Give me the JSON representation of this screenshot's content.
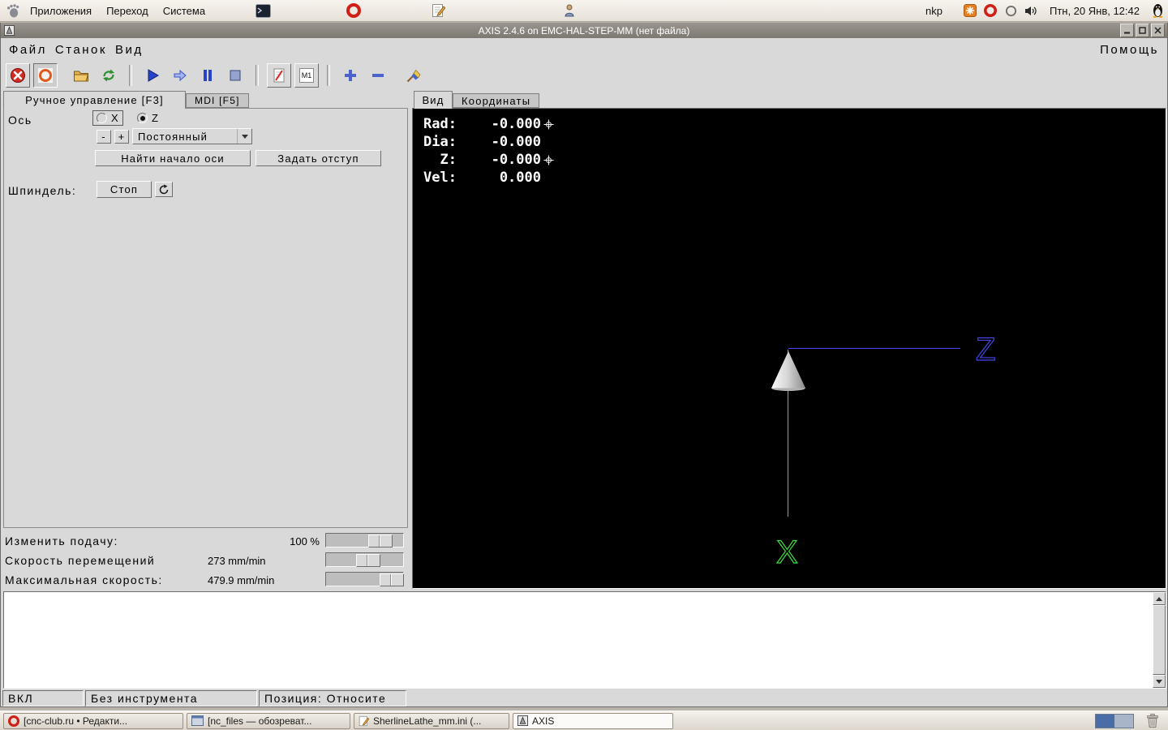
{
  "panel": {
    "applications": "Приложения",
    "places": "Переход",
    "system": "Система",
    "username": "nkp",
    "clock": "Птн, 20 Янв, 12:42"
  },
  "window": {
    "title": "AXIS 2.4.6 on EMC-HAL-STEP-MM (нет файла)",
    "menu_file": "Файл",
    "menu_machine": "Станок",
    "menu_view": "Вид",
    "menu_help": "Помощь",
    "m1": "M1"
  },
  "manual": {
    "tab_manual": "Ручное управление [F3]",
    "tab_mdi": "MDI [F5]",
    "axis_label": "Ось",
    "axis_x": "X",
    "axis_z": "Z",
    "jog_minus": "-",
    "jog_plus": "+",
    "jog_mode": "Постоянный",
    "home_button": "Найти начало оси",
    "offset_button": "Задать отступ",
    "spindle_label": "Шпиндель:",
    "spindle_stop": "Стоп"
  },
  "overrides": [
    {
      "label": "Изменить подачу:",
      "value": "100 %"
    },
    {
      "label": "Скорость перемещений",
      "value": "273 mm/min"
    },
    {
      "label": "Максимальная скорость:",
      "value": "479.9 mm/min"
    }
  ],
  "preview": {
    "tab_view": "Вид",
    "tab_coords": "Координаты",
    "dro": [
      {
        "label": "Rad:",
        "value": "-0.000"
      },
      {
        "label": "Dia:",
        "value": "-0.000"
      },
      {
        "label": "Z:",
        "value": "-0.000"
      },
      {
        "label": "Vel:",
        "value": "0.000"
      }
    ],
    "x_label": "X",
    "z_label": "Z"
  },
  "status": {
    "power": "ВКЛ",
    "tool": "Без инструмента",
    "position": "Позиция: Относите"
  },
  "taskbar": [
    {
      "label": "[cnc-club.ru • Редакти..."
    },
    {
      "label": "[nc_files — обозреват..."
    },
    {
      "label": "SherlineLathe_mm.ini (..."
    },
    {
      "label": "AXIS"
    }
  ]
}
